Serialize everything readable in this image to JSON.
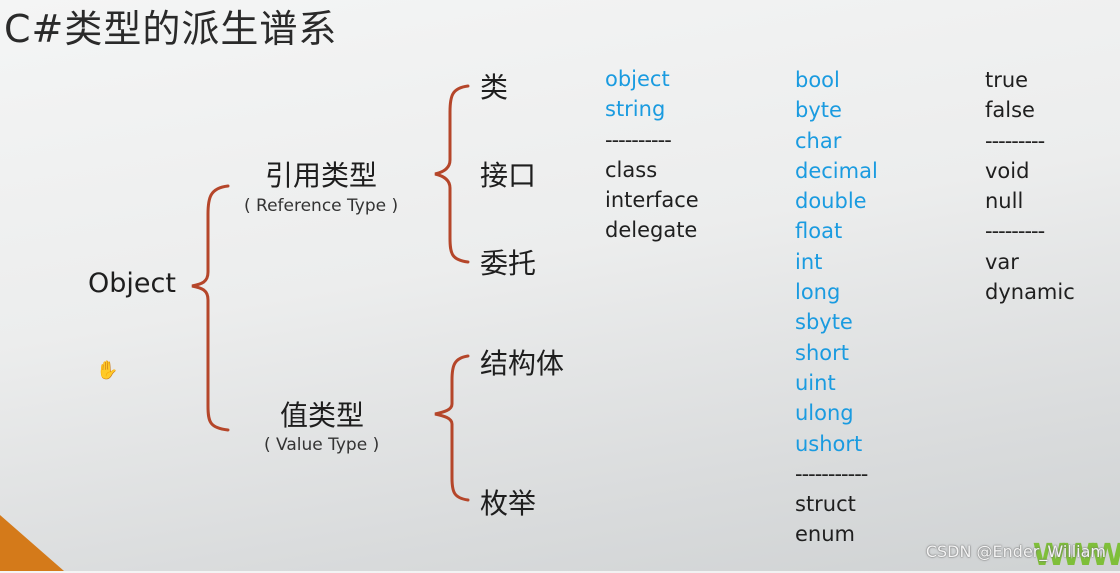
{
  "slide": {
    "title": "C#类型的派生谱系",
    "root": "Object",
    "branches": [
      {
        "label": "引用类型",
        "sublabel": "( Reference Type )",
        "children": [
          "类",
          "接口",
          "委托"
        ]
      },
      {
        "label": "值类型",
        "sublabel": "( Value Type )",
        "children": [
          "结构体",
          "枚举"
        ]
      }
    ],
    "reference_keywords": {
      "builtin": [
        "object",
        "string"
      ],
      "separator": "----------",
      "declarations": [
        "class",
        "interface",
        "delegate"
      ]
    },
    "value_keywords": {
      "builtin": [
        "bool",
        "byte",
        "char",
        "decimal",
        "double",
        "float",
        "int",
        "long",
        "sbyte",
        "short",
        "uint",
        "ulong",
        "ushort"
      ],
      "separator": "-----------",
      "declarations": [
        "struct",
        "enum"
      ]
    },
    "other_keywords": {
      "group1": [
        "true",
        "false"
      ],
      "separator1": "---------",
      "group2": [
        "void",
        "null"
      ],
      "separator2": "---------",
      "group3": [
        "var",
        "dynamic"
      ]
    },
    "colors": {
      "brace": "#b5462a",
      "keyword_blue": "#1a9be0",
      "corner_accent": "#d47a1a",
      "logo_green": "#7fbf3a"
    }
  },
  "overlay": {
    "watermark": "CSDN @Ender_William",
    "logo_text": "WWW",
    "cursor_icon": "hand-cursor"
  }
}
